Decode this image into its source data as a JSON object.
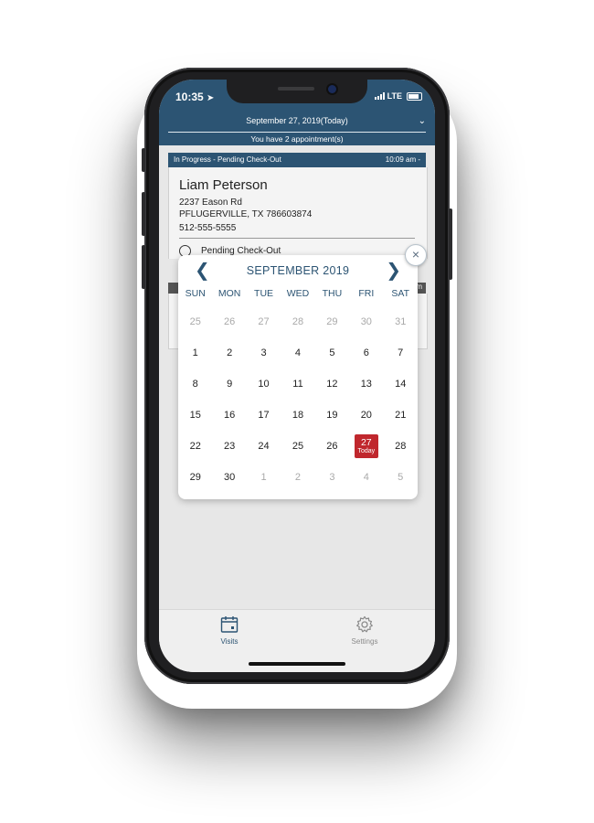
{
  "status_bar": {
    "time": "10:35",
    "network": "LTE"
  },
  "header": {
    "date": "September 27, 2019(Today)",
    "appointments": "You have 2 appointment(s)"
  },
  "card": {
    "status": "In Progress - Pending Check-Out",
    "time": "10:09 am -",
    "name": "Liam Peterson",
    "address1": "2237 Eason Rd",
    "address2": "PFLUGERVILLE, TX 786603874",
    "phone": "512-555-5555",
    "pending_label": "Pending Check-Out"
  },
  "card2": {
    "bar_suffix": "m"
  },
  "calendar": {
    "title": "SEPTEMBER 2019",
    "close_symbol": "×",
    "days_of_week": [
      "SUN",
      "MON",
      "TUE",
      "WED",
      "THU",
      "FRI",
      "SAT"
    ],
    "weeks": [
      [
        "25",
        "26",
        "27",
        "28",
        "29",
        "30",
        "31"
      ],
      [
        "1",
        "2",
        "3",
        "4",
        "5",
        "6",
        "7"
      ],
      [
        "8",
        "9",
        "10",
        "11",
        "12",
        "13",
        "14"
      ],
      [
        "15",
        "16",
        "17",
        "18",
        "19",
        "20",
        "21"
      ],
      [
        "22",
        "23",
        "24",
        "25",
        "26",
        "27",
        "28"
      ],
      [
        "29",
        "30",
        "1",
        "2",
        "3",
        "4",
        "5"
      ]
    ],
    "muted_cells": [
      [
        0,
        0
      ],
      [
        0,
        1
      ],
      [
        0,
        2
      ],
      [
        0,
        3
      ],
      [
        0,
        4
      ],
      [
        0,
        5
      ],
      [
        0,
        6
      ],
      [
        5,
        2
      ],
      [
        5,
        3
      ],
      [
        5,
        4
      ],
      [
        5,
        5
      ],
      [
        5,
        6
      ]
    ],
    "today_cell": [
      4,
      5
    ],
    "today_label": "Today",
    "accent_color": "#2c5473",
    "today_color": "#c0272d"
  },
  "tabbar": {
    "visits_label": "Visits",
    "settings_label": "Settings",
    "active_tab": "Visits"
  },
  "colors": {
    "header": "#2c5473",
    "background": "#e7e7e7"
  }
}
